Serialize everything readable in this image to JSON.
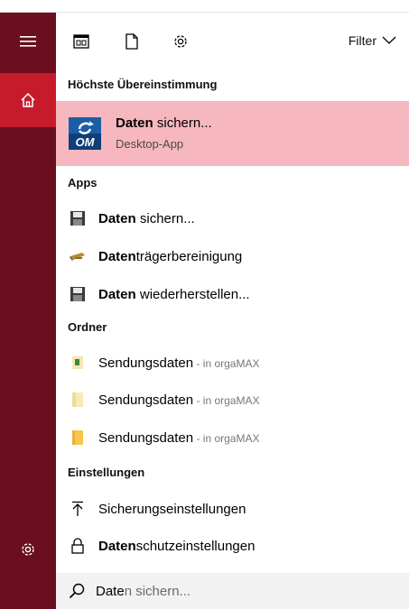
{
  "toolbar": {
    "filter_label": "Filter"
  },
  "sections": {
    "best_match": "Höchste Übereinstimmung",
    "apps": "Apps",
    "folders": "Ordner",
    "settings": "Einstellungen"
  },
  "best_match": {
    "title_bold": "Daten",
    "title_rest": " sichern...",
    "subtitle": "Desktop-App",
    "icon_text": "OM"
  },
  "apps": [
    {
      "bold": "Daten",
      "rest": " sichern...",
      "icon": "floppy-disk-icon"
    },
    {
      "bold": "Daten",
      "rest": "trägerbereinigung",
      "icon": "disk-cleanup-icon"
    },
    {
      "bold": "Daten",
      "rest": " wiederherstellen...",
      "icon": "floppy-disk-icon"
    }
  ],
  "folders": [
    {
      "name": "Sendungsdaten",
      "hint": " - in orgaMAX",
      "icon": "folder-file-icon"
    },
    {
      "name": "Sendungsdaten",
      "hint": " - in orgaMAX",
      "icon": "folder-open-icon"
    },
    {
      "name": "Sendungsdaten",
      "hint": " - in orgaMAX",
      "icon": "folder-icon"
    }
  ],
  "settings_items": [
    {
      "bold": "",
      "rest": "Sicherungseinstellungen",
      "icon": "upload-arrow-icon"
    },
    {
      "bold": "Daten",
      "rest": "schutzeinstellungen",
      "icon": "lock-icon"
    }
  ],
  "search": {
    "typed": "Date",
    "suggestion": "n sichern..."
  },
  "colors": {
    "rail": "#6b0e1d",
    "rail_active": "#c71b2b",
    "best_match_bg": "#f7b7be"
  }
}
